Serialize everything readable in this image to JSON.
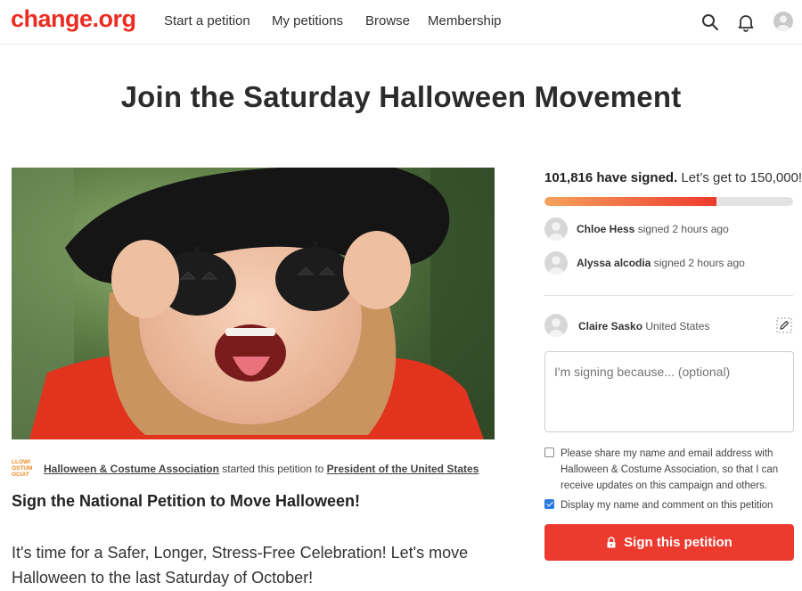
{
  "header": {
    "logo": "change.org",
    "nav": [
      "Start a petition",
      "My petitions",
      "Browse",
      "Membership"
    ],
    "icons": [
      "search-icon",
      "bell-icon",
      "user-avatar"
    ]
  },
  "petition": {
    "title": "Join the Saturday Halloween Movement",
    "starter": {
      "logo_text": "LLOWI OSTUM OCIAT",
      "name": "Halloween & Costume Association",
      "middle": " started this petition to ",
      "target": "President of the United States"
    },
    "heading": "Sign the National Petition to Move Halloween!",
    "body": "It's time for a Safer, Longer, Stress-Free Celebration! Let's move Halloween to the last Saturday of October!"
  },
  "signatures": {
    "count": "101,816 have signed.",
    "goal": " Let’s get to 150,000!",
    "progress_fraction": 0.69,
    "recent": [
      {
        "name": "Chloe Hess",
        "action": " signed 2 hours ago"
      },
      {
        "name": "Alyssa alcodia",
        "action": " signed 2 hours ago"
      }
    ]
  },
  "form": {
    "user_name": "Claire Sasko",
    "user_location": " United States",
    "comment_placeholder": "I'm signing because... (optional)",
    "share_label": "Please share my name and email address with Halloween & Costume Association, so that I can receive updates on this campaign and others.",
    "share_checked": false,
    "display_label": "Display my name and comment on this petition",
    "display_checked": true,
    "submit_label": "Sign this petition"
  },
  "colors": {
    "brand": "#ec2c22",
    "button": "#ec3a2f",
    "progress_start": "#f5a25d",
    "progress_end": "#ee3a2c",
    "checkbox_checked": "#2a7ae2"
  }
}
